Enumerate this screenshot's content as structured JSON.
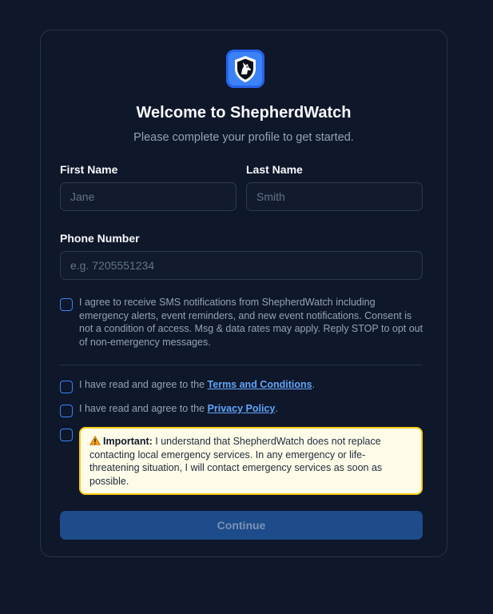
{
  "brand": {
    "logo_icon": "shepherd-dog-shield-icon",
    "accent_color": "#3b82f6"
  },
  "header": {
    "title": "Welcome to ShepherdWatch",
    "subtitle": "Please complete your profile to get started."
  },
  "form": {
    "first_name": {
      "label": "First Name",
      "placeholder": "Jane",
      "value": ""
    },
    "last_name": {
      "label": "Last Name",
      "placeholder": "Smith",
      "value": ""
    },
    "phone": {
      "label": "Phone Number",
      "placeholder": "e.g. 7205551234",
      "value": ""
    },
    "sms_consent": {
      "checked": false,
      "text": "I agree to receive SMS notifications from ShepherdWatch including emergency alerts, event reminders, and new event notifications. Consent is not a condition of access. Msg & data rates may apply. Reply STOP to opt out of non-emergency messages."
    },
    "terms": {
      "checked": false,
      "prefix": "I have read and agree to the ",
      "link": "Terms and Conditions",
      "suffix": "."
    },
    "privacy": {
      "checked": false,
      "prefix": "I have read and agree to the ",
      "link": "Privacy Policy",
      "suffix": "."
    },
    "emergency": {
      "checked": false,
      "icon": "warning-icon",
      "strong": "Important:",
      "text": " I understand that ShepherdWatch does not replace contacting local emergency services. In any emergency or life-threatening situation, I will contact emergency services as soon as possible.",
      "box_color": "#fefce8",
      "border_color": "#facc15"
    },
    "submit_label": "Continue"
  }
}
